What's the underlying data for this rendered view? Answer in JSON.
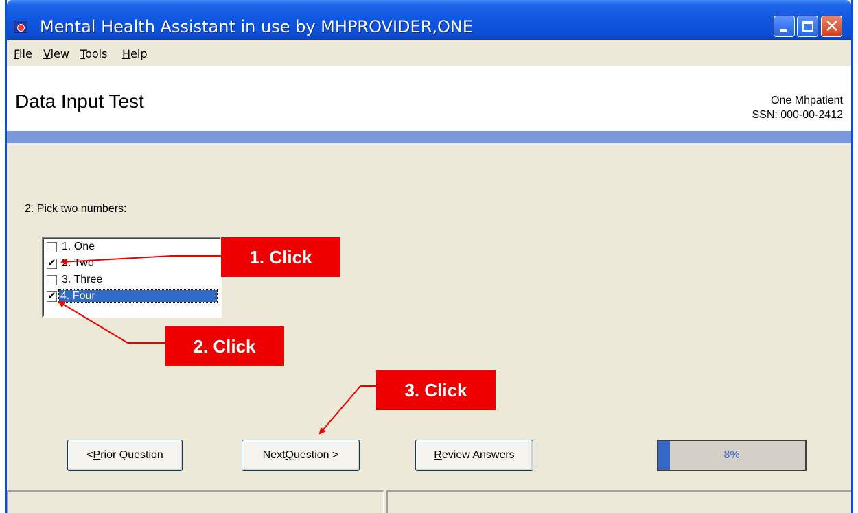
{
  "window": {
    "title": "Mental Health Assistant in use by MHPROVIDER,ONE",
    "icons": {
      "app": "app-icon",
      "minimize": "minimize-icon",
      "maximize": "maximize-icon",
      "close": "close-icon"
    }
  },
  "menu": {
    "items": [
      {
        "label": "File",
        "accel": "F",
        "rest": "ile"
      },
      {
        "label": "View",
        "accel": "V",
        "rest": "iew"
      },
      {
        "label": "Tools",
        "accel": "T",
        "rest": "ools"
      },
      {
        "label": "Help",
        "accel": "H",
        "rest": "elp"
      }
    ]
  },
  "header": {
    "title": "Data Input Test",
    "patient_name": "One Mhpatient",
    "patient_ssn": "SSN: 000-00-2412"
  },
  "question": {
    "text": "2. Pick two numbers:",
    "options": [
      {
        "label": "1. One",
        "checked": false,
        "selected": false
      },
      {
        "label": "2. Two",
        "checked": true,
        "selected": false
      },
      {
        "label": "3. Three",
        "checked": false,
        "selected": false
      },
      {
        "label": "4. Four",
        "checked": true,
        "selected": true
      }
    ]
  },
  "callouts": {
    "step1": "1. Click",
    "step2": "2. Click",
    "step3": "3. Click",
    "color": "#ee0000"
  },
  "buttons": {
    "prior": {
      "prefix": "< ",
      "accel": "P",
      "rest": "rior Question"
    },
    "next": {
      "prefix": "Next ",
      "accel": "Q",
      "rest": "uestion >"
    },
    "review": {
      "prefix": "",
      "accel": "R",
      "rest": "eview Answers"
    }
  },
  "progress": {
    "value": 0.08,
    "label": "8%"
  },
  "colors": {
    "titlebar": "#0c4fd4",
    "band": "#7b98db",
    "selection": "#316ac5",
    "face": "#ece9d8"
  }
}
